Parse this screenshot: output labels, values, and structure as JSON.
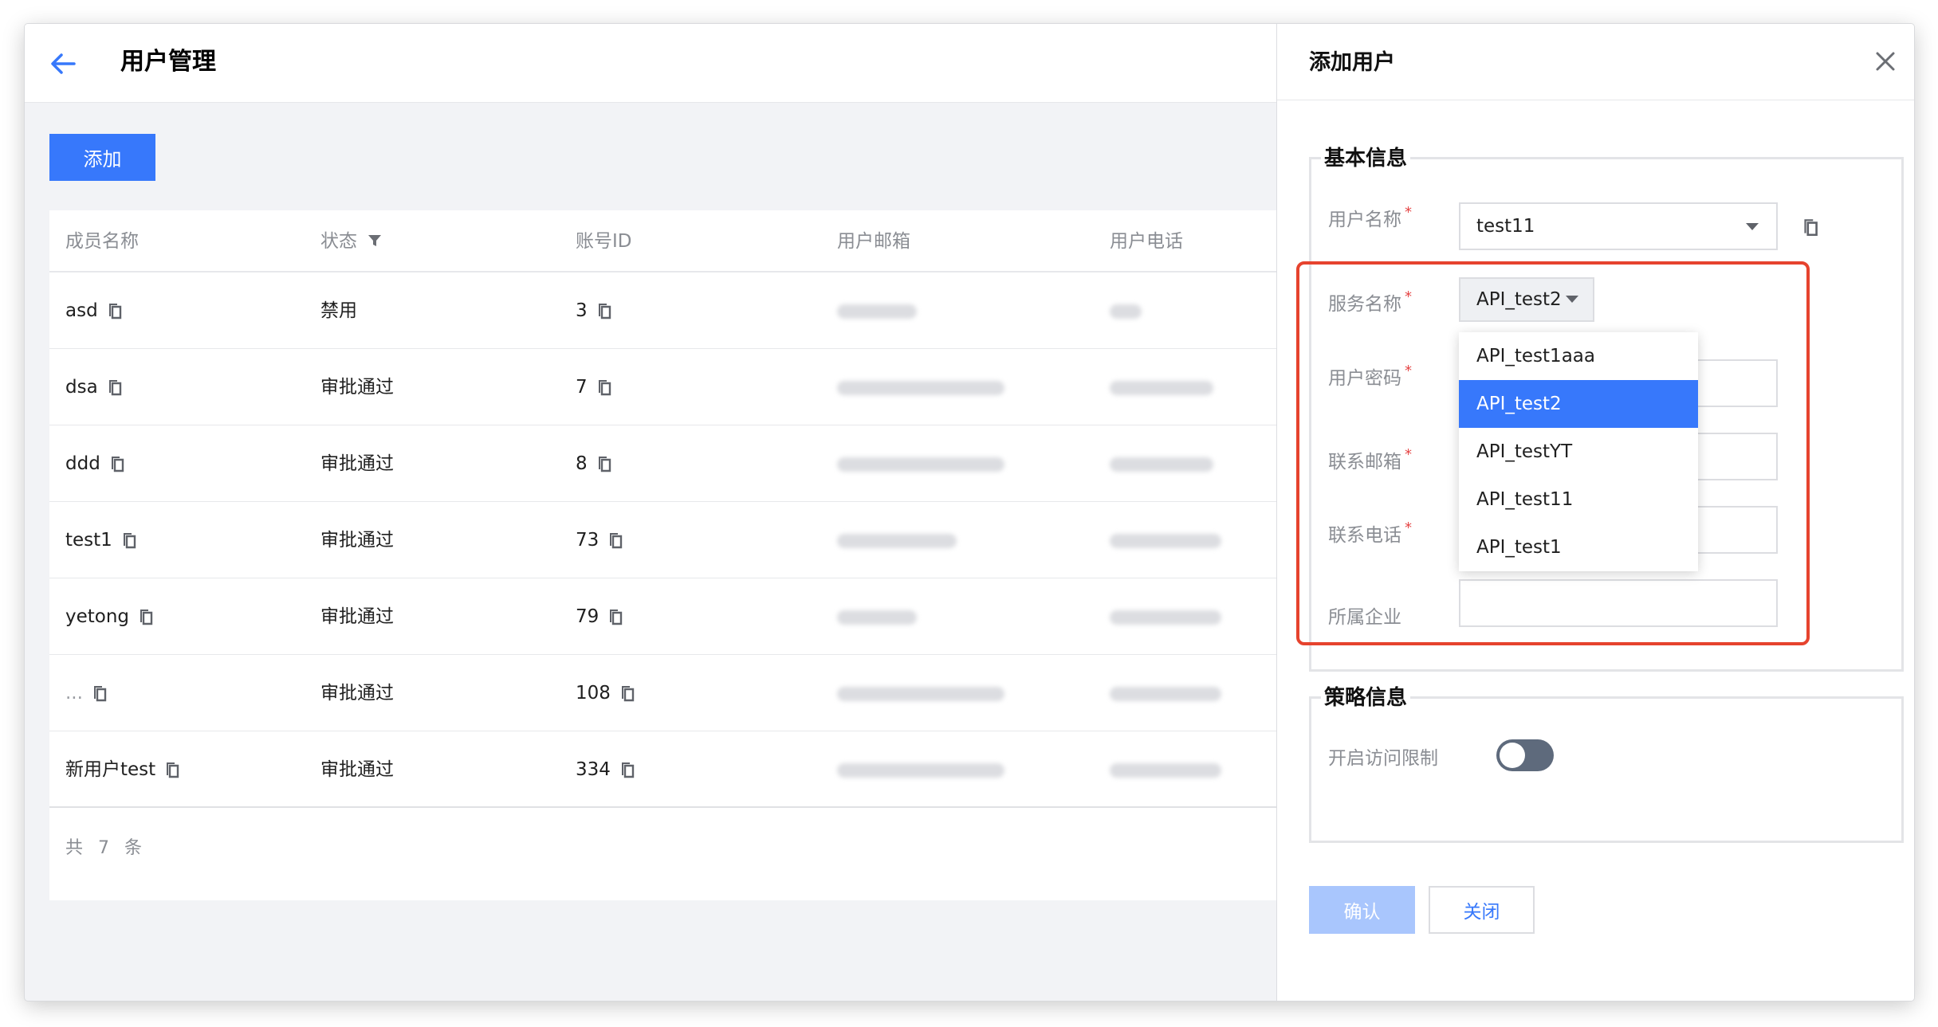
{
  "page": {
    "title": "用户管理",
    "add_button_label": "添加"
  },
  "table": {
    "columns": [
      "成员名称",
      "状态",
      "账号ID",
      "用户邮箱",
      "用户电话"
    ],
    "rows": [
      {
        "name": "asd",
        "status": "禁用",
        "id": "3"
      },
      {
        "name": "dsa",
        "status": "审批通过",
        "id": "7"
      },
      {
        "name": "ddd",
        "status": "审批通过",
        "id": "8"
      },
      {
        "name": "test1",
        "status": "审批通过",
        "id": "73"
      },
      {
        "name": "yetong",
        "status": "审批通过",
        "id": "79"
      },
      {
        "name": "...",
        "status": "审批通过",
        "id": "108"
      },
      {
        "name": "新用户test",
        "status": "审批通过",
        "id": "334"
      }
    ],
    "footer": "共 7 条"
  },
  "drawer": {
    "title": "添加用户",
    "basic_section": "基本信息",
    "fields": {
      "username_label": "用户名称",
      "username_value": "test11",
      "service_label": "服务名称",
      "service_value": "API_test2",
      "password_label": "用户密码",
      "email_label": "联系邮箱",
      "phone_label": "联系电话",
      "company_label": "所属企业",
      "required_mark": "*"
    },
    "service_options": [
      "API_test1aaa",
      "API_test2",
      "API_testYT",
      "API_test11",
      "API_test1"
    ],
    "policy_section": "策略信息",
    "access_limit_label": "开启访问限制",
    "access_limit_on": false,
    "confirm_label": "确认",
    "close_label": "关闭"
  },
  "colors": {
    "primary": "#3778fb",
    "highlight": "#e6432e",
    "muted_text": "#8a8d93"
  }
}
